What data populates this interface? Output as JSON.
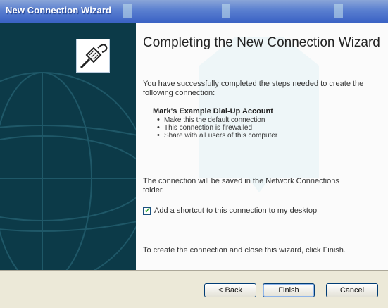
{
  "window": {
    "title": "New Connection Wizard"
  },
  "content": {
    "heading": "Completing the New Connection Wizard",
    "intro": "You have successfully completed the steps needed to create the following connection:",
    "connection_name": "Mark's Example Dial-Up Account",
    "bullets": [
      "Make this the default connection",
      "This connection is firewalled",
      "Share with all users of this computer"
    ],
    "saved_note": "The connection will be saved in the Network Connections folder.",
    "shortcut_checkbox": {
      "label": "Add a shortcut to this connection to my desktop",
      "checked": true
    },
    "finish_note": "To create the connection and close this wizard, click Finish."
  },
  "buttons": {
    "back": "< Back",
    "finish": "Finish",
    "cancel": "Cancel"
  },
  "icons": {
    "wizard": "network-cable-icon",
    "side_art": "globe-icon"
  },
  "colors": {
    "title_bar": "#3a62c4",
    "side_panel": "#0c3a48",
    "content_bg": "#fbfbfb",
    "footer_bg": "#ece9d8"
  }
}
